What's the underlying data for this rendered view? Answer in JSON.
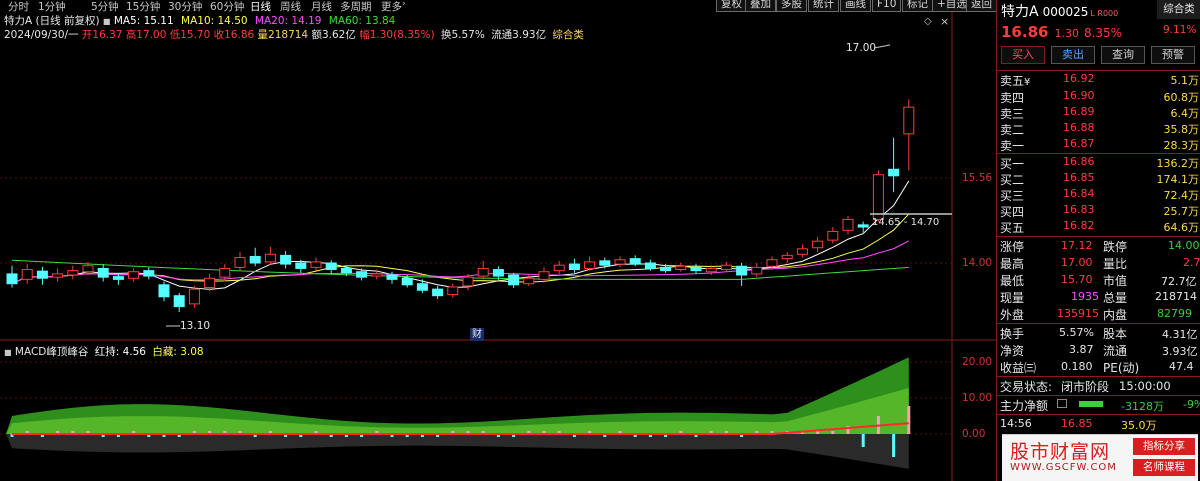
{
  "toolbar": {
    "periods": [
      "分时",
      "1分钟",
      "5分钟",
      "15分钟",
      "30分钟",
      "60分钟",
      "日线",
      "周线",
      "月线",
      "多周期",
      "更多"
    ],
    "active_period": "日线",
    "tools": [
      "复权",
      "叠加",
      "多股",
      "统计",
      "画线",
      "F10",
      "标记",
      "+自选",
      "返回"
    ]
  },
  "info": {
    "stock_name": "特力A",
    "adjust": "(日线 前复权)",
    "ma5": "MA5: 15.11",
    "ma10": "MA10: 14.50",
    "ma20": "MA20: 14.19",
    "ma60": "MA60: 13.84",
    "date": "2024/09/30/一",
    "open": "开16.37",
    "high": "高17.00",
    "low": "低15.70",
    "close": "收16.86",
    "volume": "量218714",
    "amount": "额3.62亿",
    "amplitude": "幅1.30(8.35%)",
    "turnover": "换5.57%",
    "float_cap": "流通3.93亿",
    "sector": "综合类"
  },
  "chart": {
    "annotations": {
      "high_label": "17.00",
      "low_label": "13.10",
      "range_label": "14.65 - 14.70",
      "event_marker": "财"
    },
    "price_axis": [
      "15.56",
      "14.00"
    ],
    "macd_axis": [
      "20.00",
      "10.00",
      "0.00"
    ],
    "macd_title": "MACD峰顶峰谷",
    "macd_red": "红持: 4.56",
    "macd_white": "白藏: 3.08",
    "colors": {
      "up": "#ff3c3c",
      "down": "#54ffff",
      "ma5": "#ffffff",
      "ma10": "#ffff4d",
      "ma20": "#ff4dff",
      "ma60": "#3cdc3c"
    }
  },
  "quote": {
    "name": "特力A",
    "code": "000025",
    "tag": "L R000",
    "sector_tab": "综合类",
    "sector_pct": "9.11%",
    "price": "16.86",
    "change": "1.30",
    "pct": "8.35%",
    "buttons": [
      "买入",
      "卖出",
      "查询",
      "预警"
    ],
    "sell_label_extra": "¥",
    "asks": [
      {
        "label": "卖五",
        "price": "16.92",
        "vol": "5.1万"
      },
      {
        "label": "卖四",
        "price": "16.90",
        "vol": "60.8万"
      },
      {
        "label": "卖三",
        "price": "16.89",
        "vol": "6.4万"
      },
      {
        "label": "卖二",
        "price": "16.88",
        "vol": "35.8万"
      },
      {
        "label": "卖一",
        "price": "16.87",
        "vol": "28.3万"
      }
    ],
    "bids": [
      {
        "label": "买一",
        "price": "16.86",
        "vol": "136.2万"
      },
      {
        "label": "买二",
        "price": "16.85",
        "vol": "174.1万"
      },
      {
        "label": "买三",
        "price": "16.84",
        "vol": "72.4万"
      },
      {
        "label": "买四",
        "price": "16.83",
        "vol": "25.7万"
      },
      {
        "label": "买五",
        "price": "16.82",
        "vol": "64.6万"
      }
    ],
    "stats": {
      "limit_up_l": "涨停",
      "limit_up": "17.12",
      "limit_down_l": "跌停",
      "limit_down": "14.00",
      "high_l": "最高",
      "high": "17.00",
      "vol_ratio_l": "量比",
      "vol_ratio": "2.7",
      "low_l": "最低",
      "low": "15.70",
      "mkt_val_l": "市值",
      "mkt_val": "72.7亿",
      "cur_vol_l": "现量",
      "cur_vol": "1935",
      "total_vol_l": "总量",
      "total_vol": "218714",
      "outer_l": "外盘",
      "outer": "135915",
      "inner_l": "内盘",
      "inner": "82799",
      "turnover_l": "换手",
      "turnover": "5.57%",
      "capital_l": "股本",
      "capital": "4.31亿",
      "nav_l": "净资",
      "nav": "3.87",
      "float_l": "流通",
      "float": "3.93亿",
      "eps_l": "收益㈢",
      "eps": "0.180",
      "pe_l": "PE(动)",
      "pe": "47.4"
    },
    "trade_state_l": "交易状态:",
    "trade_state": "闭市阶段",
    "trade_time": "15:00:00",
    "main_flow_l": "主力净额",
    "main_flow": "-3128万",
    "main_flow_pct": "-9%",
    "tick_time": "14:56",
    "tick_price": "16.85",
    "tick_vol": "35.0万"
  },
  "watermark": {
    "title": "股市财富网",
    "url": "WWW.GSCFW.COM",
    "badge1": "指标分享",
    "badge2": "名师课程"
  }
}
